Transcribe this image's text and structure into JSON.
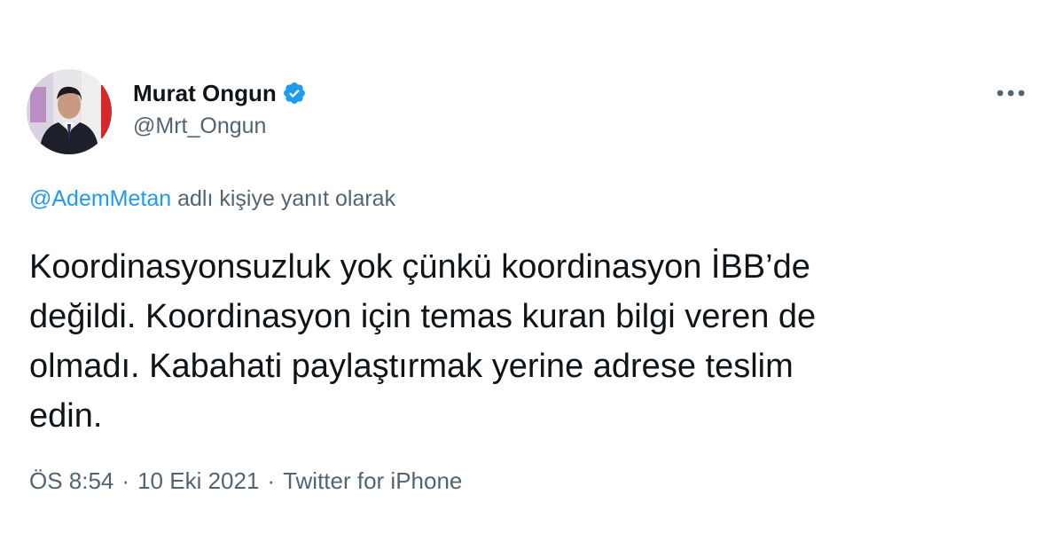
{
  "author": {
    "display_name": "Murat Ongun",
    "handle": "@Mrt_Ongun",
    "verified": true
  },
  "reply": {
    "mention": "@AdemMetan",
    "suffix": "adlı kişiye yanıt olarak"
  },
  "tweet": {
    "lines": [
      "Koordinasyonsuzluk yok çünkü koordinasyon İBB’de",
      "değildi. Koordinasyon için temas kuran bilgi veren de",
      "olmadı. Kabahati paylaştırmak yerine adrese teslim",
      "edin."
    ]
  },
  "meta": {
    "time": "ÖS 8:54",
    "separator": "·",
    "date": "10 Eki 2021",
    "source": "Twitter for iPhone"
  },
  "icons": {
    "verified": "verified-badge-icon",
    "more": "more-options-icon"
  },
  "colors": {
    "accent": "#1d9bf0",
    "text": "#0f1419",
    "secondary": "#536471"
  }
}
